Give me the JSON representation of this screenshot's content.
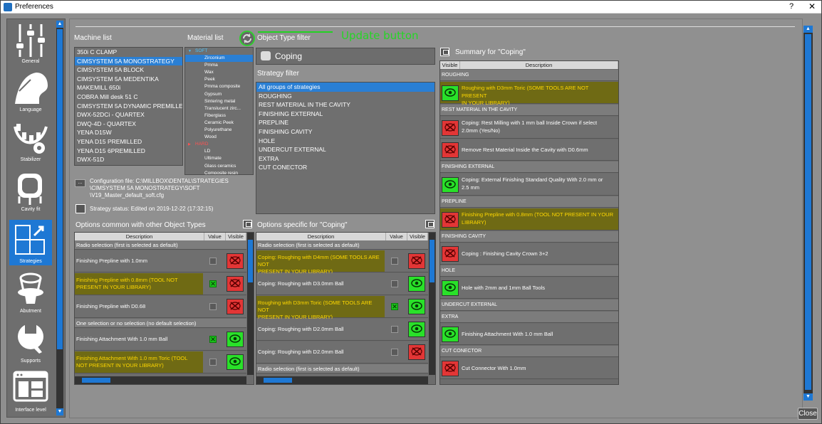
{
  "window": {
    "title": "Preferences",
    "help": "?",
    "close": "✕"
  },
  "sidebar": {
    "items": [
      {
        "label": "General",
        "icon": "sliders-icon"
      },
      {
        "label": "Language",
        "icon": "language-icon"
      },
      {
        "label": "Stabilizer",
        "icon": "stabilizer-icon"
      },
      {
        "label": "Cavity fit",
        "icon": "cavity-fit-icon"
      },
      {
        "label": "Strategies",
        "icon": "strategies-icon",
        "active": true
      },
      {
        "label": "Abutment",
        "icon": "abutment-icon"
      },
      {
        "label": "Supports",
        "icon": "supports-icon"
      },
      {
        "label": "Interface level",
        "icon": "interface-level-icon"
      }
    ]
  },
  "machine_list": {
    "header": "Machine list",
    "items": [
      "350i C CLAMP",
      "CIMSYSTEM 5A MONOSTRATEGY",
      "CIMSYSTEM 5A BLOCK",
      "CIMSYSTEM 5A MEDENTIKA",
      "MAKEMILL 650i",
      "COBRA Mill desk 51 C",
      "CIMSYSTEM 5A DYNAMIC PREMILLED",
      "DWX-52DCi - QUARTEX",
      "DWQ-4D - QUARTEX",
      "YENA D15W",
      "YENA D15 PREMILLED",
      "YENA D15 6PREMILLED",
      "DWX-51D"
    ],
    "selected": 1
  },
  "material_list": {
    "header": "Material list",
    "soft_label": "SOFT",
    "hard_label": "HARD",
    "soft": [
      "Zirconium",
      "Pmma",
      "Wax",
      "Peek",
      "Pmma composite",
      "Gypsum",
      "Sintering metal",
      "Translucent zirc...",
      "Fiberglass",
      "Ceramic Peek",
      "Polyurethane",
      "Wood"
    ],
    "hard": [
      "LD",
      "Ultimate",
      "Glass ceramics",
      "Composite resin"
    ],
    "selected": 0
  },
  "object_type": {
    "header": "Object Type filter",
    "value": "Coping",
    "update_label": "Update button"
  },
  "strategy_filter": {
    "header": "Strategy filter",
    "items": [
      "All groups of strategies",
      "ROUGHING",
      "REST MATERIAL IN THE CAVITY",
      "FINISHING EXTERNAL",
      "PREPLINE",
      "FINISHING CAVITY",
      "HOLE",
      "UNDERCUT EXTERNAL",
      "EXTRA",
      "CUT CONECTOR"
    ],
    "selected": 0
  },
  "config": {
    "btn": "...",
    "file_line1": "Configuration file: C:\\MILLBOX\\DENTAL\\STRATEGIES",
    "file_line2": "\\CIMSYSTEM 5A MONOSTRATEGY\\SOFT",
    "file_line3": "\\V19_Master_default_soft.cfg",
    "status": "Strategy status: Edited on 2019-12-22 (17:32:15)"
  },
  "common_options": {
    "header": "Options common with other Object Types",
    "cols": [
      "Description",
      "Value",
      "Visible"
    ],
    "rows": [
      {
        "type": "sec",
        "d1": "Radio selection (first is selected as default)"
      },
      {
        "type": "opt",
        "d1": "Finishing Prepline with 1.0mm",
        "d2": "",
        "warn": false,
        "value": false,
        "visible": false
      },
      {
        "type": "opt",
        "d1": "Finishing Prepline with 0.8mm (TOOL NOT",
        "d2": "PRESENT IN YOUR LIBRARY)",
        "warn": true,
        "value": true,
        "visible": false
      },
      {
        "type": "opt",
        "d1": "Finishing Prepline with D0.68",
        "d2": "",
        "warn": false,
        "value": false,
        "visible": false
      },
      {
        "type": "sec",
        "d1": "One selection or no selection (no default selection)"
      },
      {
        "type": "opt",
        "d1": "Finishing Attachment With 1.0 mm Ball",
        "d2": "",
        "warn": false,
        "value": true,
        "visible": true
      },
      {
        "type": "opt",
        "d1": "Finishing Attachment With 1.0 mm Toric (TOOL",
        "d2": "NOT PRESENT IN YOUR LIBRARY)",
        "warn": true,
        "value": false,
        "visible": true
      }
    ]
  },
  "specific_options": {
    "header": "Options specific for \"Coping\"",
    "cols": [
      "Description",
      "Value",
      "Visible"
    ],
    "rows": [
      {
        "type": "sec",
        "d1": "Radio selection (first is selected as default)"
      },
      {
        "type": "opt",
        "d1": "Coping: Roughing with D4mm (SOME TOOLS ARE NOT",
        "d2": "PRESENT IN YOUR LIBRARY)",
        "warn": true,
        "value": false,
        "visible": false
      },
      {
        "type": "opt",
        "d1": "Coping: Roughing with D3.0mm Ball",
        "d2": "",
        "warn": false,
        "value": false,
        "visible": true
      },
      {
        "type": "opt",
        "d1": "Roughing with D3mm Toric (SOME TOOLS ARE NOT",
        "d2": "PRESENT IN YOUR LIBRARY)",
        "warn": true,
        "value": true,
        "visible": true
      },
      {
        "type": "opt",
        "d1": "Coping: Roughing with D2.0mm Ball",
        "d2": "",
        "warn": false,
        "value": false,
        "visible": true
      },
      {
        "type": "opt",
        "d1": "Coping: Roughing with D2.0mm Ball",
        "d2": "",
        "warn": false,
        "value": false,
        "visible": false
      },
      {
        "type": "sec",
        "d1": "Radio selection (first is selected as default)"
      }
    ]
  },
  "summary": {
    "header": "Summary for \"Coping\"",
    "cols": [
      "Visible",
      "Description"
    ],
    "rows": [
      {
        "type": "sec",
        "label": "ROUGHING"
      },
      {
        "type": "opt",
        "visible": true,
        "warn": true,
        "d1": "Roughing with D3mm Toric (SOME TOOLS ARE NOT PRESENT",
        "d2": "IN YOUR LIBRARY)"
      },
      {
        "type": "sec",
        "label": "REST MATERIAL IN THE CAVITY"
      },
      {
        "type": "opt",
        "visible": false,
        "warn": false,
        "d1": "Coping: Rest Milling with 1 mm ball Inside Crown if select",
        "d2": "2.0mm (Yes/No)"
      },
      {
        "type": "opt",
        "visible": false,
        "warn": false,
        "d1": "Remove Rest Material Inside the Cavity with D0.6mm",
        "d2": ""
      },
      {
        "type": "sec",
        "label": "FINISHING EXTERNAL"
      },
      {
        "type": "opt",
        "visible": true,
        "warn": false,
        "d1": "Coping: External Finishing Standard Quality With 2.0 mm or",
        "d2": "2.5 mm"
      },
      {
        "type": "sec",
        "label": "PREPLINE"
      },
      {
        "type": "opt",
        "visible": false,
        "warn": true,
        "d1": "Finishing Prepline with 0.8mm (TOOL NOT PRESENT IN YOUR",
        "d2": "LIBRARY)"
      },
      {
        "type": "sec",
        "label": "FINISHING CAVITY"
      },
      {
        "type": "opt",
        "visible": false,
        "warn": false,
        "d1": "Coping : Finishing Cavity Crown 3+2",
        "d2": ""
      },
      {
        "type": "sec",
        "label": "HOLE"
      },
      {
        "type": "opt",
        "visible": true,
        "warn": false,
        "d1": "Hole with 2mm and 1mm Ball Tools",
        "d2": ""
      },
      {
        "type": "sec",
        "label": "UNDERCUT EXTERNAL"
      },
      {
        "type": "sec",
        "label": "EXTRA"
      },
      {
        "type": "opt",
        "visible": true,
        "warn": false,
        "d1": "Finishing Attachment With 1.0 mm Ball",
        "d2": ""
      },
      {
        "type": "sec",
        "label": "CUT CONECTOR"
      },
      {
        "type": "opt",
        "visible": false,
        "warn": false,
        "d1": "Cut Connector With 1.0mm",
        "d2": ""
      }
    ]
  },
  "footer": {
    "close_label": "Close"
  },
  "colors": {
    "accent": "#1e78d4",
    "update": "#26d626",
    "warn_text": "#ffd800",
    "visible_on": "#29e129",
    "visible_off": "#e33636"
  }
}
